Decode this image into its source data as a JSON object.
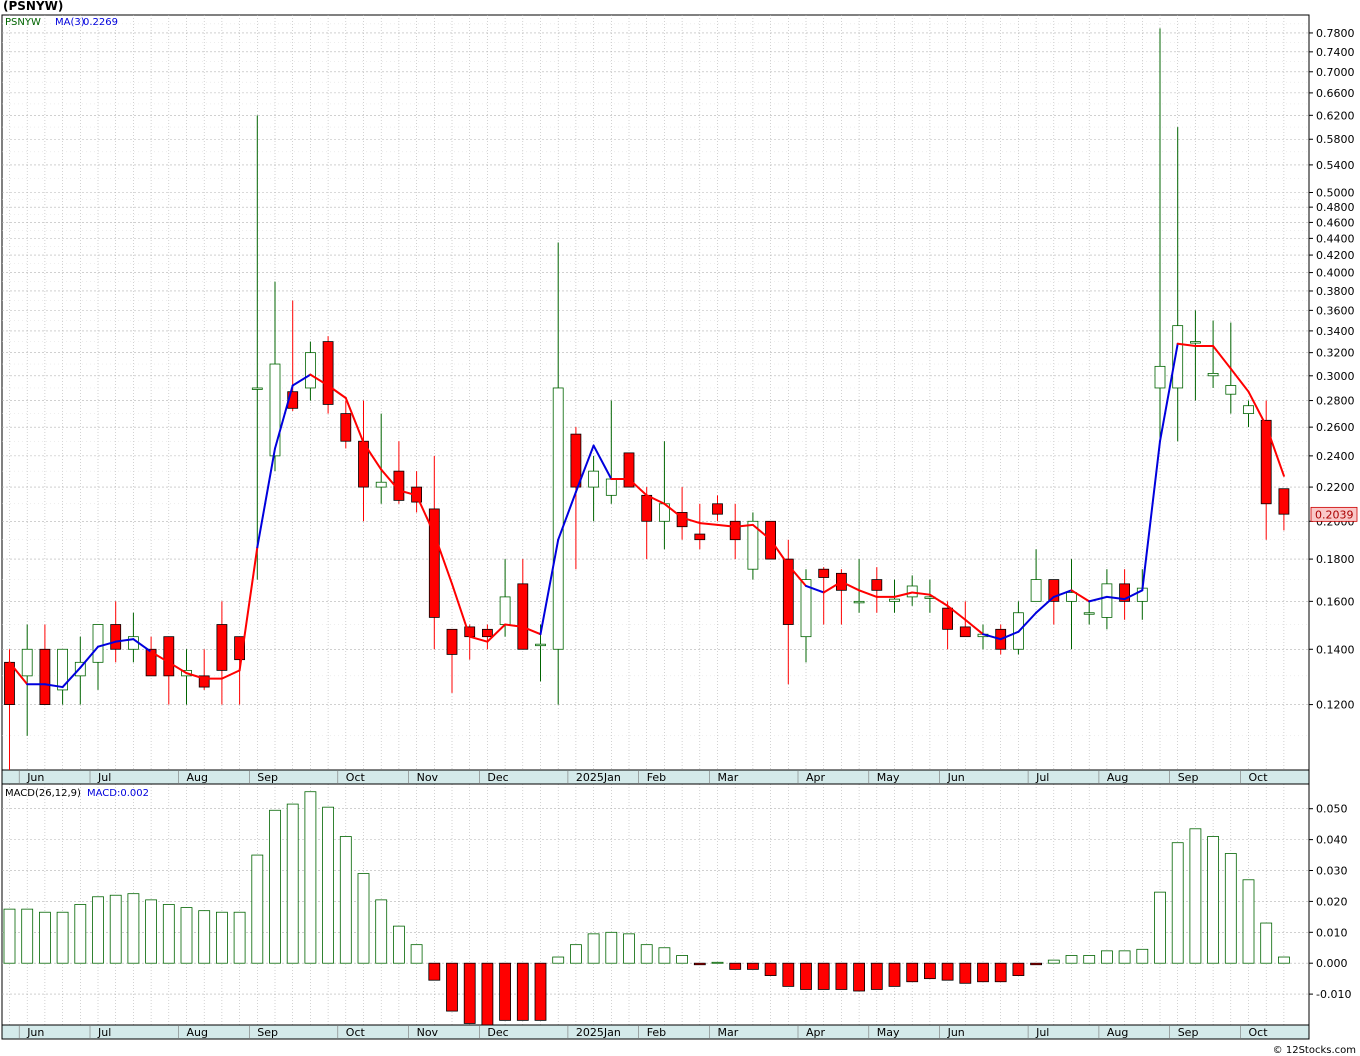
{
  "title": "(PSNYW)",
  "footer": "© 12Stocks.com",
  "colors": {
    "up": "#006400",
    "down": "#ff0000",
    "ma_up": "#0000dd",
    "ma_down": "#ff0000",
    "grid": "#b4b4b4",
    "axis_band": "#d4eaea",
    "last_price_bg": "#f9c8c8"
  },
  "chart_data": [
    {
      "type": "candlestick",
      "scale": "log",
      "title": "(PSNYW)",
      "legend": {
        "symbol": "PSNYW",
        "ma_label": "MA(3)",
        "ma_value": "0.2269"
      },
      "last_price_label": "0.2039",
      "ylim": [
        0.1,
        0.82
      ],
      "yticks": [
        0.12,
        0.14,
        0.16,
        0.18,
        0.2,
        0.22,
        0.24,
        0.26,
        0.28,
        0.3,
        0.32,
        0.34,
        0.36,
        0.38,
        0.4,
        0.42,
        0.44,
        0.46,
        0.48,
        0.5,
        0.54,
        0.58,
        0.62,
        0.66,
        0.7,
        0.74,
        0.78
      ],
      "ytick_labels": [
        "0.1200",
        "0.1400",
        "0.1600",
        "0.1800",
        "0.2000",
        "0.2200",
        "0.2400",
        "0.2600",
        "0.2800",
        "0.3000",
        "0.3200",
        "0.3400",
        "0.3600",
        "0.3800",
        "0.4000",
        "0.4200",
        "0.4400",
        "0.4600",
        "0.4800",
        "0.5000",
        "0.5400",
        "0.5800",
        "0.6200",
        "0.6600",
        "0.7000",
        "0.7400",
        "0.7800"
      ],
      "month_labels": [
        {
          "label": "Jun",
          "week": 1
        },
        {
          "label": "Jul",
          "week": 5
        },
        {
          "label": "Aug",
          "week": 10
        },
        {
          "label": "Sep",
          "week": 14
        },
        {
          "label": "Oct",
          "week": 19
        },
        {
          "label": "Nov",
          "week": 23
        },
        {
          "label": "Dec",
          "week": 27
        },
        {
          "label": "2025Jan",
          "week": 32
        },
        {
          "label": "Feb",
          "week": 36
        },
        {
          "label": "Mar",
          "week": 40
        },
        {
          "label": "Apr",
          "week": 45
        },
        {
          "label": "May",
          "week": 49
        },
        {
          "label": "Jun",
          "week": 53
        },
        {
          "label": "Jul",
          "week": 58
        },
        {
          "label": "Aug",
          "week": 62
        },
        {
          "label": "Sep",
          "week": 66
        },
        {
          "label": "Oct",
          "week": 70
        }
      ],
      "candles": [
        [
          0.135,
          0.14,
          0.1,
          0.12
        ],
        [
          0.13,
          0.15,
          0.11,
          0.14
        ],
        [
          0.14,
          0.15,
          0.12,
          0.12
        ],
        [
          0.125,
          0.14,
          0.12,
          0.14
        ],
        [
          0.13,
          0.145,
          0.12,
          0.135
        ],
        [
          0.135,
          0.15,
          0.125,
          0.15
        ],
        [
          0.15,
          0.16,
          0.135,
          0.14
        ],
        [
          0.14,
          0.155,
          0.135,
          0.145
        ],
        [
          0.14,
          0.145,
          0.13,
          0.13
        ],
        [
          0.145,
          0.145,
          0.12,
          0.13
        ],
        [
          0.13,
          0.14,
          0.12,
          0.132
        ],
        [
          0.13,
          0.14,
          0.125,
          0.126
        ],
        [
          0.15,
          0.16,
          0.12,
          0.132
        ],
        [
          0.145,
          0.145,
          0.12,
          0.136
        ],
        [
          0.29,
          0.62,
          0.17,
          0.29
        ],
        [
          0.24,
          0.39,
          0.23,
          0.31
        ],
        [
          0.287,
          0.37,
          0.272,
          0.274
        ],
        [
          0.29,
          0.33,
          0.28,
          0.32
        ],
        [
          0.33,
          0.335,
          0.27,
          0.277
        ],
        [
          0.27,
          0.28,
          0.245,
          0.25
        ],
        [
          0.25,
          0.28,
          0.2,
          0.22
        ],
        [
          0.22,
          0.27,
          0.21,
          0.223
        ],
        [
          0.23,
          0.25,
          0.21,
          0.212
        ],
        [
          0.22,
          0.23,
          0.205,
          0.211
        ],
        [
          0.207,
          0.24,
          0.14,
          0.153
        ],
        [
          0.148,
          0.148,
          0.124,
          0.138
        ],
        [
          0.149,
          0.15,
          0.136,
          0.145
        ],
        [
          0.148,
          0.15,
          0.14,
          0.145
        ],
        [
          0.15,
          0.18,
          0.145,
          0.162
        ],
        [
          0.168,
          0.18,
          0.14,
          0.14
        ],
        [
          0.142,
          0.15,
          0.128,
          0.142
        ],
        [
          0.14,
          0.435,
          0.12,
          0.29
        ],
        [
          0.255,
          0.26,
          0.175,
          0.22
        ],
        [
          0.22,
          0.24,
          0.2,
          0.23
        ],
        [
          0.215,
          0.28,
          0.21,
          0.225
        ],
        [
          0.242,
          0.242,
          0.22,
          0.22
        ],
        [
          0.215,
          0.22,
          0.18,
          0.2
        ],
        [
          0.2,
          0.25,
          0.185,
          0.21
        ],
        [
          0.205,
          0.22,
          0.19,
          0.197
        ],
        [
          0.193,
          0.21,
          0.185,
          0.19
        ],
        [
          0.21,
          0.215,
          0.2,
          0.204
        ],
        [
          0.2,
          0.21,
          0.18,
          0.19
        ],
        [
          0.175,
          0.205,
          0.17,
          0.2
        ],
        [
          0.2,
          0.2,
          0.18,
          0.18
        ],
        [
          0.18,
          0.19,
          0.127,
          0.15
        ],
        [
          0.145,
          0.175,
          0.135,
          0.17
        ],
        [
          0.175,
          0.176,
          0.15,
          0.171
        ],
        [
          0.173,
          0.175,
          0.15,
          0.165
        ],
        [
          0.16,
          0.18,
          0.155,
          0.16
        ],
        [
          0.17,
          0.176,
          0.155,
          0.165
        ],
        [
          0.16,
          0.17,
          0.155,
          0.161
        ],
        [
          0.162,
          0.172,
          0.158,
          0.167
        ],
        [
          0.162,
          0.17,
          0.155,
          0.162
        ],
        [
          0.157,
          0.16,
          0.14,
          0.148
        ],
        [
          0.149,
          0.16,
          0.145,
          0.145
        ],
        [
          0.145,
          0.15,
          0.14,
          0.146
        ],
        [
          0.148,
          0.15,
          0.138,
          0.14
        ],
        [
          0.14,
          0.16,
          0.138,
          0.155
        ],
        [
          0.16,
          0.185,
          0.16,
          0.17
        ],
        [
          0.17,
          0.17,
          0.15,
          0.16
        ],
        [
          0.16,
          0.18,
          0.14,
          0.164
        ],
        [
          0.155,
          0.16,
          0.15,
          0.155
        ],
        [
          0.153,
          0.175,
          0.148,
          0.168
        ],
        [
          0.168,
          0.175,
          0.152,
          0.16
        ],
        [
          0.16,
          0.175,
          0.152,
          0.166
        ],
        [
          0.29,
          0.79,
          0.25,
          0.308
        ],
        [
          0.29,
          0.6,
          0.25,
          0.345
        ],
        [
          0.33,
          0.36,
          0.28,
          0.33
        ],
        [
          0.3,
          0.35,
          0.29,
          0.302
        ],
        [
          0.285,
          0.348,
          0.27,
          0.292
        ],
        [
          0.27,
          0.28,
          0.26,
          0.276
        ],
        [
          0.265,
          0.28,
          0.19,
          0.21
        ],
        [
          0.219,
          0.219,
          0.195,
          0.204
        ]
      ],
      "ma3": [
        0.135,
        0.127,
        0.127,
        0.126,
        0.133,
        0.141,
        0.143,
        0.144,
        0.139,
        0.135,
        0.131,
        0.129,
        0.129,
        0.132,
        0.186,
        0.245,
        0.292,
        0.301,
        0.292,
        0.282,
        0.249,
        0.231,
        0.218,
        0.215,
        0.193,
        0.168,
        0.145,
        0.143,
        0.15,
        0.149,
        0.146,
        0.19,
        0.217,
        0.247,
        0.225,
        0.225,
        0.215,
        0.21,
        0.202,
        0.199,
        0.198,
        0.197,
        0.198,
        0.19,
        0.177,
        0.167,
        0.164,
        0.169,
        0.165,
        0.162,
        0.162,
        0.164,
        0.163,
        0.158,
        0.152,
        0.146,
        0.144,
        0.147,
        0.155,
        0.162,
        0.165,
        0.16,
        0.162,
        0.161,
        0.165,
        0.25,
        0.328,
        0.326,
        0.326,
        0.306,
        0.287,
        0.261,
        0.227
      ],
      "ma3_turns": [
        [
          0,
          "down"
        ],
        [
          1,
          "up"
        ],
        [
          8,
          "down"
        ],
        [
          14,
          "up"
        ],
        [
          17,
          "down"
        ],
        [
          30,
          "up"
        ],
        [
          34,
          "down"
        ],
        [
          45,
          "up"
        ],
        [
          46,
          "down"
        ],
        [
          55,
          "up"
        ],
        [
          60,
          "down"
        ],
        [
          61,
          "up"
        ],
        [
          66,
          "down"
        ]
      ]
    },
    {
      "type": "bar",
      "title": "MACD(26,12,9)",
      "legend": {
        "label": "MACD(26,12,9)",
        "value_label": "MACD:0.002"
      },
      "ylim": [
        -0.02,
        0.058
      ],
      "yticks": [
        -0.01,
        0.0,
        0.01,
        0.02,
        0.03,
        0.04,
        0.05
      ],
      "ytick_labels": [
        "-0.010",
        "0.000",
        "0.010",
        "0.020",
        "0.030",
        "0.040",
        "0.050"
      ],
      "values": [
        0.0175,
        0.0175,
        0.0165,
        0.0165,
        0.019,
        0.0215,
        0.022,
        0.0225,
        0.0205,
        0.019,
        0.018,
        0.017,
        0.0165,
        0.0165,
        0.035,
        0.0495,
        0.0515,
        0.0555,
        0.0505,
        0.041,
        0.029,
        0.0205,
        0.012,
        0.006,
        -0.0055,
        -0.0155,
        -0.0195,
        -0.02,
        -0.0185,
        -0.0185,
        -0.0185,
        0.002,
        0.006,
        0.0095,
        0.01,
        0.0095,
        0.006,
        0.005,
        0.0025,
        -0.0005,
        0.0003,
        -0.002,
        -0.002,
        -0.004,
        -0.0075,
        -0.0085,
        -0.0085,
        -0.0085,
        -0.009,
        -0.0085,
        -0.0075,
        -0.006,
        -0.005,
        -0.0055,
        -0.0065,
        -0.006,
        -0.006,
        -0.004,
        -0.0005,
        0.001,
        0.0025,
        0.0025,
        0.004,
        0.004,
        0.0045,
        0.023,
        0.039,
        0.0435,
        0.041,
        0.0355,
        0.027,
        0.013,
        0.002
      ]
    }
  ]
}
